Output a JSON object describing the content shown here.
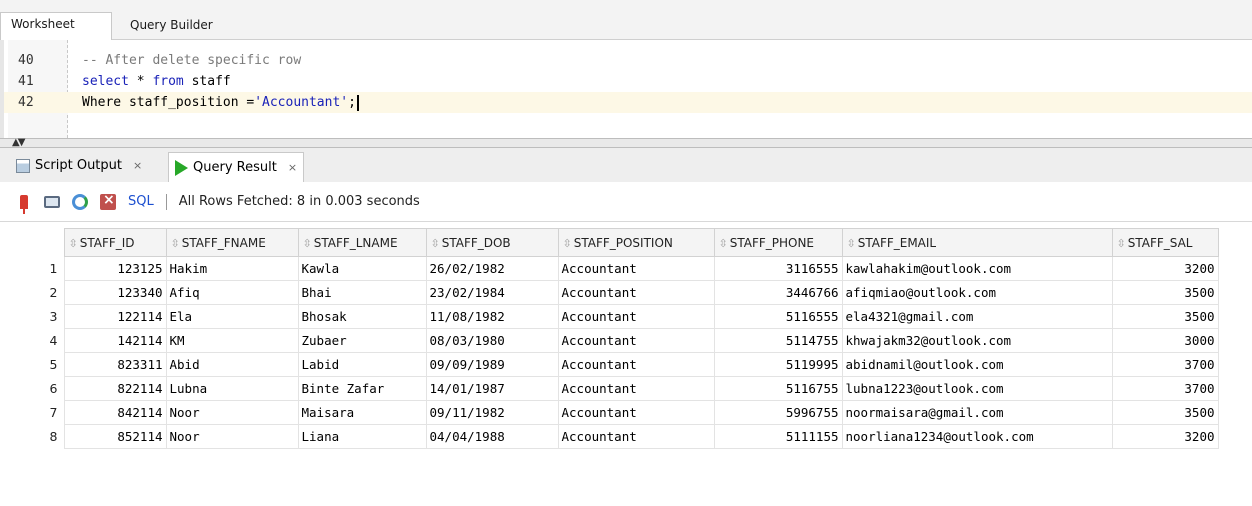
{
  "top_tabs": [
    "Worksheet",
    "Query Builder"
  ],
  "editor": {
    "lines": [
      {
        "num": "40",
        "parts": [
          {
            "t": "-- After delete specific row",
            "c": "cm"
          }
        ]
      },
      {
        "num": "41",
        "parts": [
          {
            "t": "select",
            "c": "kw"
          },
          {
            "t": " * ",
            "c": "pl"
          },
          {
            "t": "from",
            "c": "kw"
          },
          {
            "t": " staff",
            "c": "pl"
          }
        ]
      },
      {
        "num": "42",
        "parts": [
          {
            "t": "Where staff_position =",
            "c": "pl"
          },
          {
            "t": "'Accountant'",
            "c": "st"
          },
          {
            "t": ";",
            "c": "pl"
          }
        ]
      }
    ]
  },
  "result_tabs": {
    "script_output": "Script Output",
    "query_result": "Query Result",
    "close_glyph": "×"
  },
  "toolbar": {
    "sql_label": "SQL",
    "status": "All Rows Fetched: 8 in 0.003 seconds"
  },
  "grid": {
    "columns": [
      "STAFF_ID",
      "STAFF_FNAME",
      "STAFF_LNAME",
      "STAFF_DOB",
      "STAFF_POSITION",
      "STAFF_PHONE",
      "STAFF_EMAIL",
      "STAFF_SAL"
    ],
    "rows": [
      [
        "1",
        "123125",
        "Hakim",
        "Kawla",
        "26/02/1982",
        "Accountant",
        "3116555",
        "kawlahakim@outlook.com",
        "3200"
      ],
      [
        "2",
        "123340",
        "Afiq",
        "Bhai",
        "23/02/1984",
        "Accountant",
        "3446766",
        "afiqmiao@outlook.com",
        "3500"
      ],
      [
        "3",
        "122114",
        "Ela",
        "Bhosak",
        "11/08/1982",
        "Accountant",
        "5116555",
        "ela4321@gmail.com",
        "3500"
      ],
      [
        "4",
        "142114",
        "KM",
        "Zubaer",
        "08/03/1980",
        "Accountant",
        "5114755",
        "khwajakm32@outlook.com",
        "3000"
      ],
      [
        "5",
        "823311",
        "Abid",
        "Labid",
        "09/09/1989",
        "Accountant",
        "5119995",
        "abidnamil@outlook.com",
        "3700"
      ],
      [
        "6",
        "822114",
        "Lubna",
        "Binte Zafar",
        "14/01/1987",
        "Accountant",
        "5116755",
        "lubna1223@outlook.com",
        "3700"
      ],
      [
        "7",
        "842114",
        "Noor",
        "Maisara",
        "09/11/1982",
        "Accountant",
        "5996755",
        "noormaisara@gmail.com",
        "3500"
      ],
      [
        "8",
        "852114",
        "Noor",
        "Liana",
        "04/04/1988",
        "Accountant",
        "5111155",
        "noorliana1234@outlook.com",
        "3200"
      ]
    ]
  }
}
